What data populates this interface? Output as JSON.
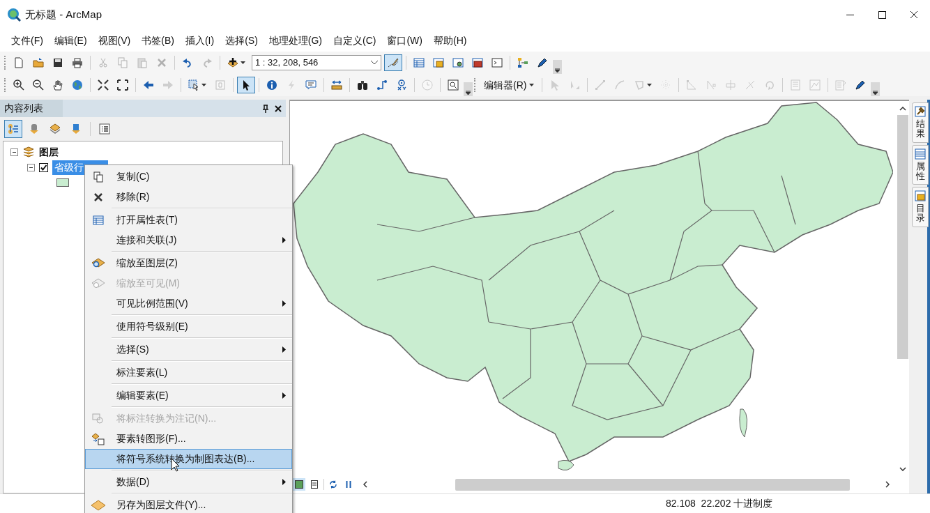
{
  "window": {
    "title": "无标题 - ArcMap"
  },
  "menu_bar": [
    {
      "label": "文件(F)"
    },
    {
      "label": "编辑(E)"
    },
    {
      "label": "视图(V)"
    },
    {
      "label": "书签(B)"
    },
    {
      "label": "插入(I)"
    },
    {
      "label": "选择(S)"
    },
    {
      "label": "地理处理(G)"
    },
    {
      "label": "自定义(C)"
    },
    {
      "label": "窗口(W)"
    },
    {
      "label": "帮助(H)"
    }
  ],
  "toolbars": [
    [
      {
        "kind": "button",
        "disabled": false,
        "selected": false
      },
      {
        "kind": "button",
        "disabled": false,
        "selected": false
      },
      {
        "kind": "button",
        "disabled": false,
        "selected": false
      },
      {
        "kind": "button",
        "disabled": false,
        "selected": false
      },
      {
        "kind": "separator"
      },
      {
        "kind": "button",
        "disabled": true,
        "selected": false
      },
      {
        "kind": "button",
        "disabled": true,
        "selected": false
      },
      {
        "kind": "button",
        "disabled": true,
        "selected": false
      },
      {
        "kind": "button",
        "disabled": true,
        "selected": false
      },
      {
        "kind": "separator"
      },
      {
        "kind": "button",
        "disabled": false,
        "selected": false
      },
      {
        "kind": "button",
        "disabled": true,
        "selected": false
      },
      {
        "kind": "separator"
      },
      {
        "kind": "dropdown",
        "disabled": false,
        "selected": false
      },
      {
        "kind": "combo",
        "value": "1 : 32, 208, 546"
      },
      {
        "kind": "button",
        "disabled": false,
        "selected": true
      },
      {
        "kind": "separator"
      },
      {
        "kind": "button",
        "disabled": false,
        "selected": false
      },
      {
        "kind": "button",
        "disabled": false,
        "selected": false
      },
      {
        "kind": "button",
        "disabled": false,
        "selected": false
      },
      {
        "kind": "button",
        "disabled": false,
        "selected": false
      },
      {
        "kind": "button",
        "disabled": false,
        "selected": false
      },
      {
        "kind": "separator"
      },
      {
        "kind": "button",
        "disabled": false,
        "selected": false
      },
      {
        "kind": "button",
        "disabled": false,
        "selected": false
      },
      {
        "kind": "overflow"
      }
    ],
    [
      {
        "kind": "button",
        "disabled": false,
        "selected": false
      },
      {
        "kind": "button",
        "disabled": false,
        "selected": false
      },
      {
        "kind": "button",
        "disabled": false,
        "selected": false
      },
      {
        "kind": "button",
        "disabled": false,
        "selected": false
      },
      {
        "kind": "separator"
      },
      {
        "kind": "button",
        "disabled": false,
        "selected": false
      },
      {
        "kind": "button",
        "disabled": false,
        "selected": false
      },
      {
        "kind": "separator"
      },
      {
        "kind": "button",
        "disabled": false,
        "selected": false
      },
      {
        "kind": "button",
        "disabled": true,
        "selected": false
      },
      {
        "kind": "separator"
      },
      {
        "kind": "dropdown",
        "disabled": false,
        "selected": false
      },
      {
        "kind": "button",
        "disabled": true,
        "selected": false
      },
      {
        "kind": "separator"
      },
      {
        "kind": "button",
        "disabled": false,
        "selected": true
      },
      {
        "kind": "separator"
      },
      {
        "kind": "button",
        "disabled": false,
        "selected": false
      },
      {
        "kind": "button",
        "disabled": true,
        "selected": false
      },
      {
        "kind": "button",
        "disabled": false,
        "selected": false
      },
      {
        "kind": "separator"
      },
      {
        "kind": "button",
        "disabled": false,
        "selected": false
      },
      {
        "kind": "separator"
      },
      {
        "kind": "button",
        "disabled": false,
        "selected": false
      },
      {
        "kind": "button",
        "disabled": false,
        "selected": false
      },
      {
        "kind": "button",
        "disabled": false,
        "selected": false
      },
      {
        "kind": "separator"
      },
      {
        "kind": "button",
        "disabled": true,
        "selected": false
      },
      {
        "kind": "separator"
      },
      {
        "kind": "button",
        "disabled": false,
        "selected": false
      },
      {
        "kind": "overflow"
      },
      {
        "kind": "menu",
        "label": "编辑器(R)"
      },
      {
        "kind": "separator"
      },
      {
        "kind": "button",
        "disabled": true,
        "selected": false
      },
      {
        "kind": "button",
        "disabled": true,
        "selected": false
      },
      {
        "kind": "separator"
      },
      {
        "kind": "button",
        "disabled": true,
        "selected": false
      },
      {
        "kind": "button",
        "disabled": true,
        "selected": false
      },
      {
        "kind": "dropdown",
        "disabled": true,
        "selected": false
      },
      {
        "kind": "button",
        "disabled": true,
        "selected": false
      },
      {
        "kind": "separator"
      },
      {
        "kind": "button",
        "disabled": true,
        "selected": false
      },
      {
        "kind": "button",
        "disabled": true,
        "selected": false
      },
      {
        "kind": "button",
        "disabled": true,
        "selected": false
      },
      {
        "kind": "button",
        "disabled": true,
        "selected": false
      },
      {
        "kind": "button",
        "disabled": true,
        "selected": false
      },
      {
        "kind": "separator"
      },
      {
        "kind": "button",
        "disabled": true,
        "selected": false
      },
      {
        "kind": "button",
        "disabled": true,
        "selected": false
      },
      {
        "kind": "separator"
      },
      {
        "kind": "button",
        "disabled": true,
        "selected": false
      },
      {
        "kind": "button",
        "disabled": false,
        "selected": false
      },
      {
        "kind": "overflow"
      }
    ]
  ],
  "toc": {
    "title": "内容列表",
    "view_buttons": [
      {
        "selected": true
      },
      {
        "selected": false
      },
      {
        "selected": false
      },
      {
        "selected": false
      },
      {
        "selected": false
      }
    ],
    "tree": [
      {
        "label": "图层",
        "expanded": true,
        "children": [
          {
            "label": "省级行",
            "checked": true,
            "selected": true,
            "expanded": true
          }
        ]
      }
    ]
  },
  "context_menu": [
    [
      {
        "label": "复制(C)",
        "disabled": false,
        "selected": false,
        "submenu": false
      },
      {
        "label": "移除(R)",
        "disabled": false,
        "selected": false,
        "submenu": false
      }
    ],
    [
      {
        "label": "打开属性表(T)",
        "disabled": false,
        "selected": false,
        "submenu": false
      },
      {
        "label": "连接和关联(J)",
        "disabled": false,
        "selected": false,
        "submenu": true
      }
    ],
    [
      {
        "label": "缩放至图层(Z)",
        "disabled": false,
        "selected": false,
        "submenu": false
      },
      {
        "label": "缩放至可见(M)",
        "disabled": true,
        "selected": false,
        "submenu": false
      },
      {
        "label": "可见比例范围(V)",
        "disabled": false,
        "selected": false,
        "submenu": true
      }
    ],
    [
      {
        "label": "使用符号级别(E)",
        "disabled": false,
        "selected": false,
        "submenu": false
      }
    ],
    [
      {
        "label": "选择(S)",
        "disabled": false,
        "selected": false,
        "submenu": true
      }
    ],
    [
      {
        "label": "标注要素(L)",
        "disabled": false,
        "selected": false,
        "submenu": false
      }
    ],
    [
      {
        "label": "编辑要素(E)",
        "disabled": false,
        "selected": false,
        "submenu": true
      }
    ],
    [
      {
        "label": "将标注转换为注记(N)...",
        "disabled": true,
        "selected": false,
        "submenu": false
      },
      {
        "label": "要素转图形(F)...",
        "disabled": false,
        "selected": false,
        "submenu": false
      },
      {
        "label": "将符号系统转换为制图表达(B)...",
        "disabled": false,
        "selected": true,
        "submenu": false
      }
    ],
    [
      {
        "label": "数据(D)",
        "disabled": false,
        "selected": false,
        "submenu": true
      }
    ],
    [
      {
        "label": "另存为图层文件(Y)...",
        "disabled": false,
        "selected": false,
        "submenu": false
      }
    ]
  ],
  "dock_tabs": [
    {
      "label": "结果"
    },
    {
      "label": "属性"
    },
    {
      "label": "目录"
    }
  ],
  "status_bar": {
    "coordinates": "82.108  22.202 十进制度"
  }
}
